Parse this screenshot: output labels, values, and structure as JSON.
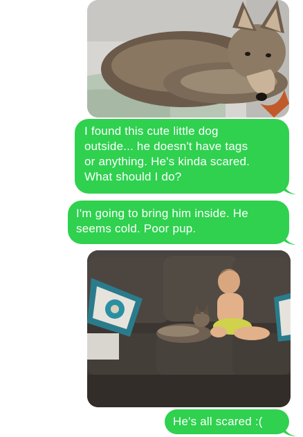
{
  "conversation": {
    "messages": [
      {
        "type": "image",
        "description_icon": "coyote-photo"
      },
      {
        "type": "text",
        "text": "I found this cute little dog\noutside... he doesn't have tags\nor anything. He's kinda scared.\nWhat should I do?"
      },
      {
        "type": "text",
        "text": "I'm going to bring him inside. He\nseems cold. Poor pup."
      },
      {
        "type": "image",
        "description_icon": "couch-photo"
      },
      {
        "type": "text",
        "text": "He's all scared :("
      }
    ]
  },
  "colors": {
    "bubble_green": "#2fd14f",
    "background": "#ffffff"
  }
}
